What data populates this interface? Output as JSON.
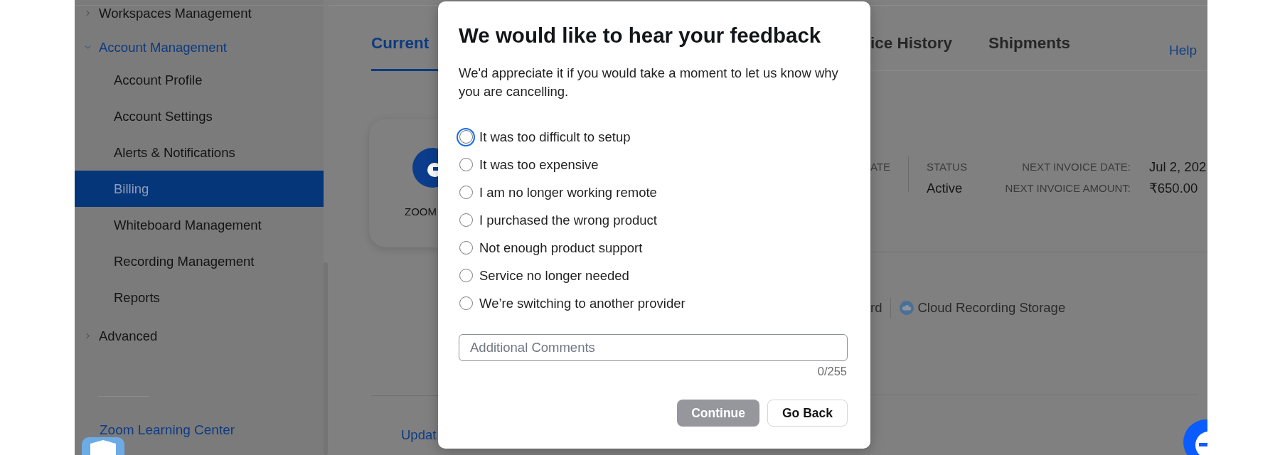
{
  "sidebar": {
    "items": [
      {
        "label": "Workspaces Management",
        "expanded": false
      },
      {
        "label": "Account Management",
        "expanded": true,
        "children": [
          {
            "label": "Account Profile",
            "selected": false
          },
          {
            "label": "Account Settings",
            "selected": false
          },
          {
            "label": "Alerts & Notifications",
            "selected": false
          },
          {
            "label": "Billing",
            "selected": true
          },
          {
            "label": "Whiteboard Management",
            "selected": false
          },
          {
            "label": "Recording Management",
            "selected": false
          },
          {
            "label": "Reports",
            "selected": false
          }
        ]
      },
      {
        "label": "Advanced",
        "expanded": false
      }
    ],
    "footer_link": "Zoom Learning Center"
  },
  "tabs": [
    {
      "label": "Current",
      "selected": true
    },
    {
      "label": "ice History",
      "selected": false
    },
    {
      "label": "Shipments",
      "selected": false
    }
  ],
  "help_link": "Help",
  "plan_card": {
    "label": "ZOOM"
  },
  "plan_summary": {
    "columns": [
      {
        "label": "ATE"
      },
      {
        "label": "STATUS",
        "value": "Active"
      }
    ],
    "invoice": [
      {
        "label": "NEXT INVOICE DATE:",
        "value": "Jul 2, 202"
      },
      {
        "label": "NEXT INVOICE AMOUNT:",
        "value": "₹650.00"
      }
    ]
  },
  "features": [
    {
      "label": "rd",
      "kind": "plain"
    },
    {
      "label": "Cloud Recording Storage",
      "kind": "cloud"
    }
  ],
  "update_link": "Updat",
  "dialog": {
    "title": "We would like to hear your feedback",
    "intro": "We'd appreciate it if you would take a moment to let us know why you are cancelling.",
    "options": [
      {
        "label": "It was too difficult to setup",
        "selected": false,
        "focused": true
      },
      {
        "label": "It was too expensive",
        "selected": false,
        "focused": false
      },
      {
        "label": "I am no longer working remote",
        "selected": false,
        "focused": false
      },
      {
        "label": "I purchased the wrong product",
        "selected": false,
        "focused": false
      },
      {
        "label": "Not enough product support",
        "selected": false,
        "focused": false
      },
      {
        "label": "Service no longer needed",
        "selected": false,
        "focused": false
      },
      {
        "label": "We’re switching to another provider",
        "selected": false,
        "focused": false
      }
    ],
    "comments": {
      "placeholder": "Additional Comments",
      "counter": "0/255"
    },
    "buttons": [
      {
        "label": "Continue",
        "kind": "primary",
        "disabled": true
      },
      {
        "label": "Go Back",
        "kind": "secondary",
        "disabled": false
      }
    ]
  }
}
